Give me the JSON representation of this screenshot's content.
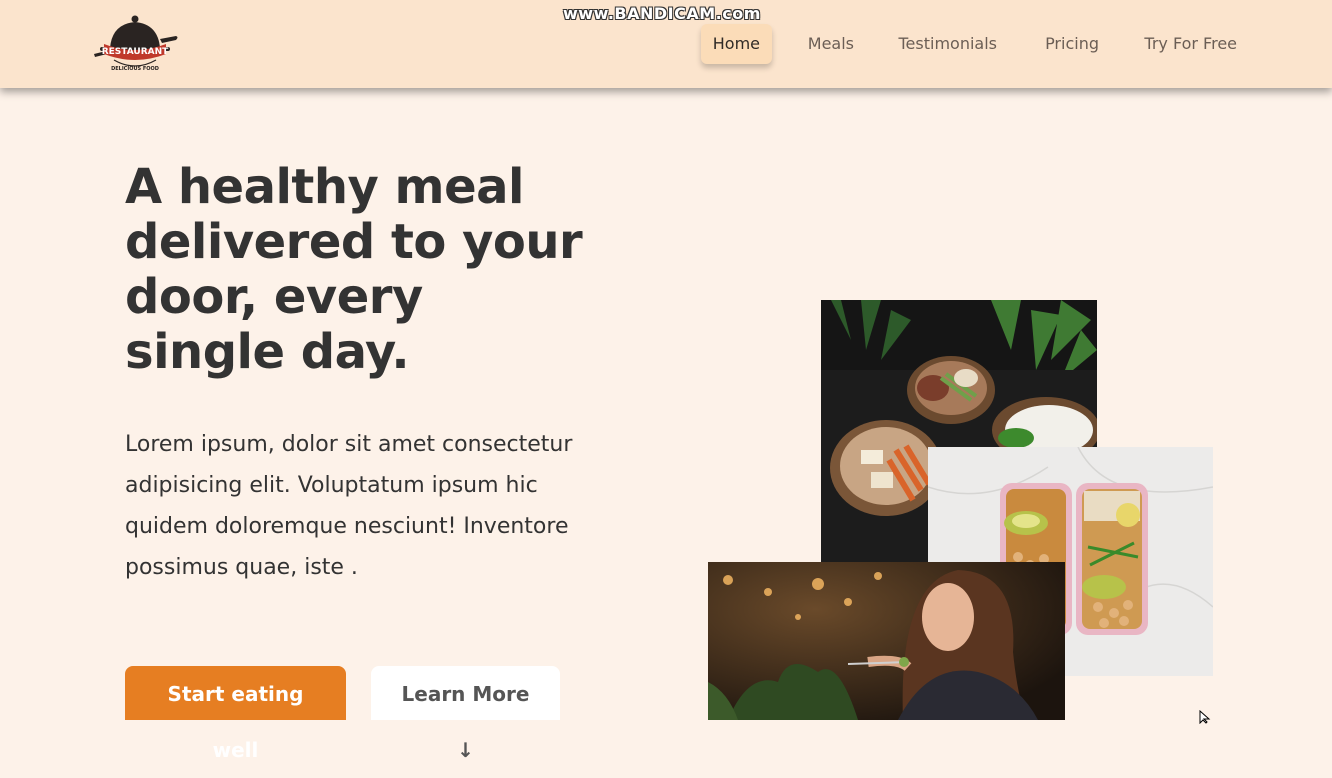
{
  "watermark": "www.BANDICAM.com",
  "brand": {
    "logo_icon": "restaurant-cloche-logo",
    "logo_text": "RESTAURANT",
    "logo_subtext": "DELICIOUS FOOD"
  },
  "nav": {
    "items": [
      {
        "label": "Home",
        "active": true
      },
      {
        "label": "Meals",
        "active": false
      },
      {
        "label": "Testimonials",
        "active": false
      },
      {
        "label": "Pricing",
        "active": false
      },
      {
        "label": "Try For Free",
        "active": false
      }
    ]
  },
  "hero": {
    "title": "A healthy meal delivered to your door, every single day.",
    "description": "Lorem ipsum, dolor sit amet consectetur adipisicing elit. Voluptatum ipsum hic quidem doloremque nesciunt! Inventore possimus quae, iste .",
    "primary_button": "Start eating well",
    "secondary_button": "Learn More ↓"
  },
  "images": {
    "bowls": "food-bowls-photo",
    "boxes": "meal-prep-boxes-photo",
    "woman": "woman-eating-photo"
  },
  "colors": {
    "accent": "#e67e22",
    "header_bg": "#fbe4cd",
    "page_bg": "#fdf2e9",
    "text": "#333333"
  }
}
